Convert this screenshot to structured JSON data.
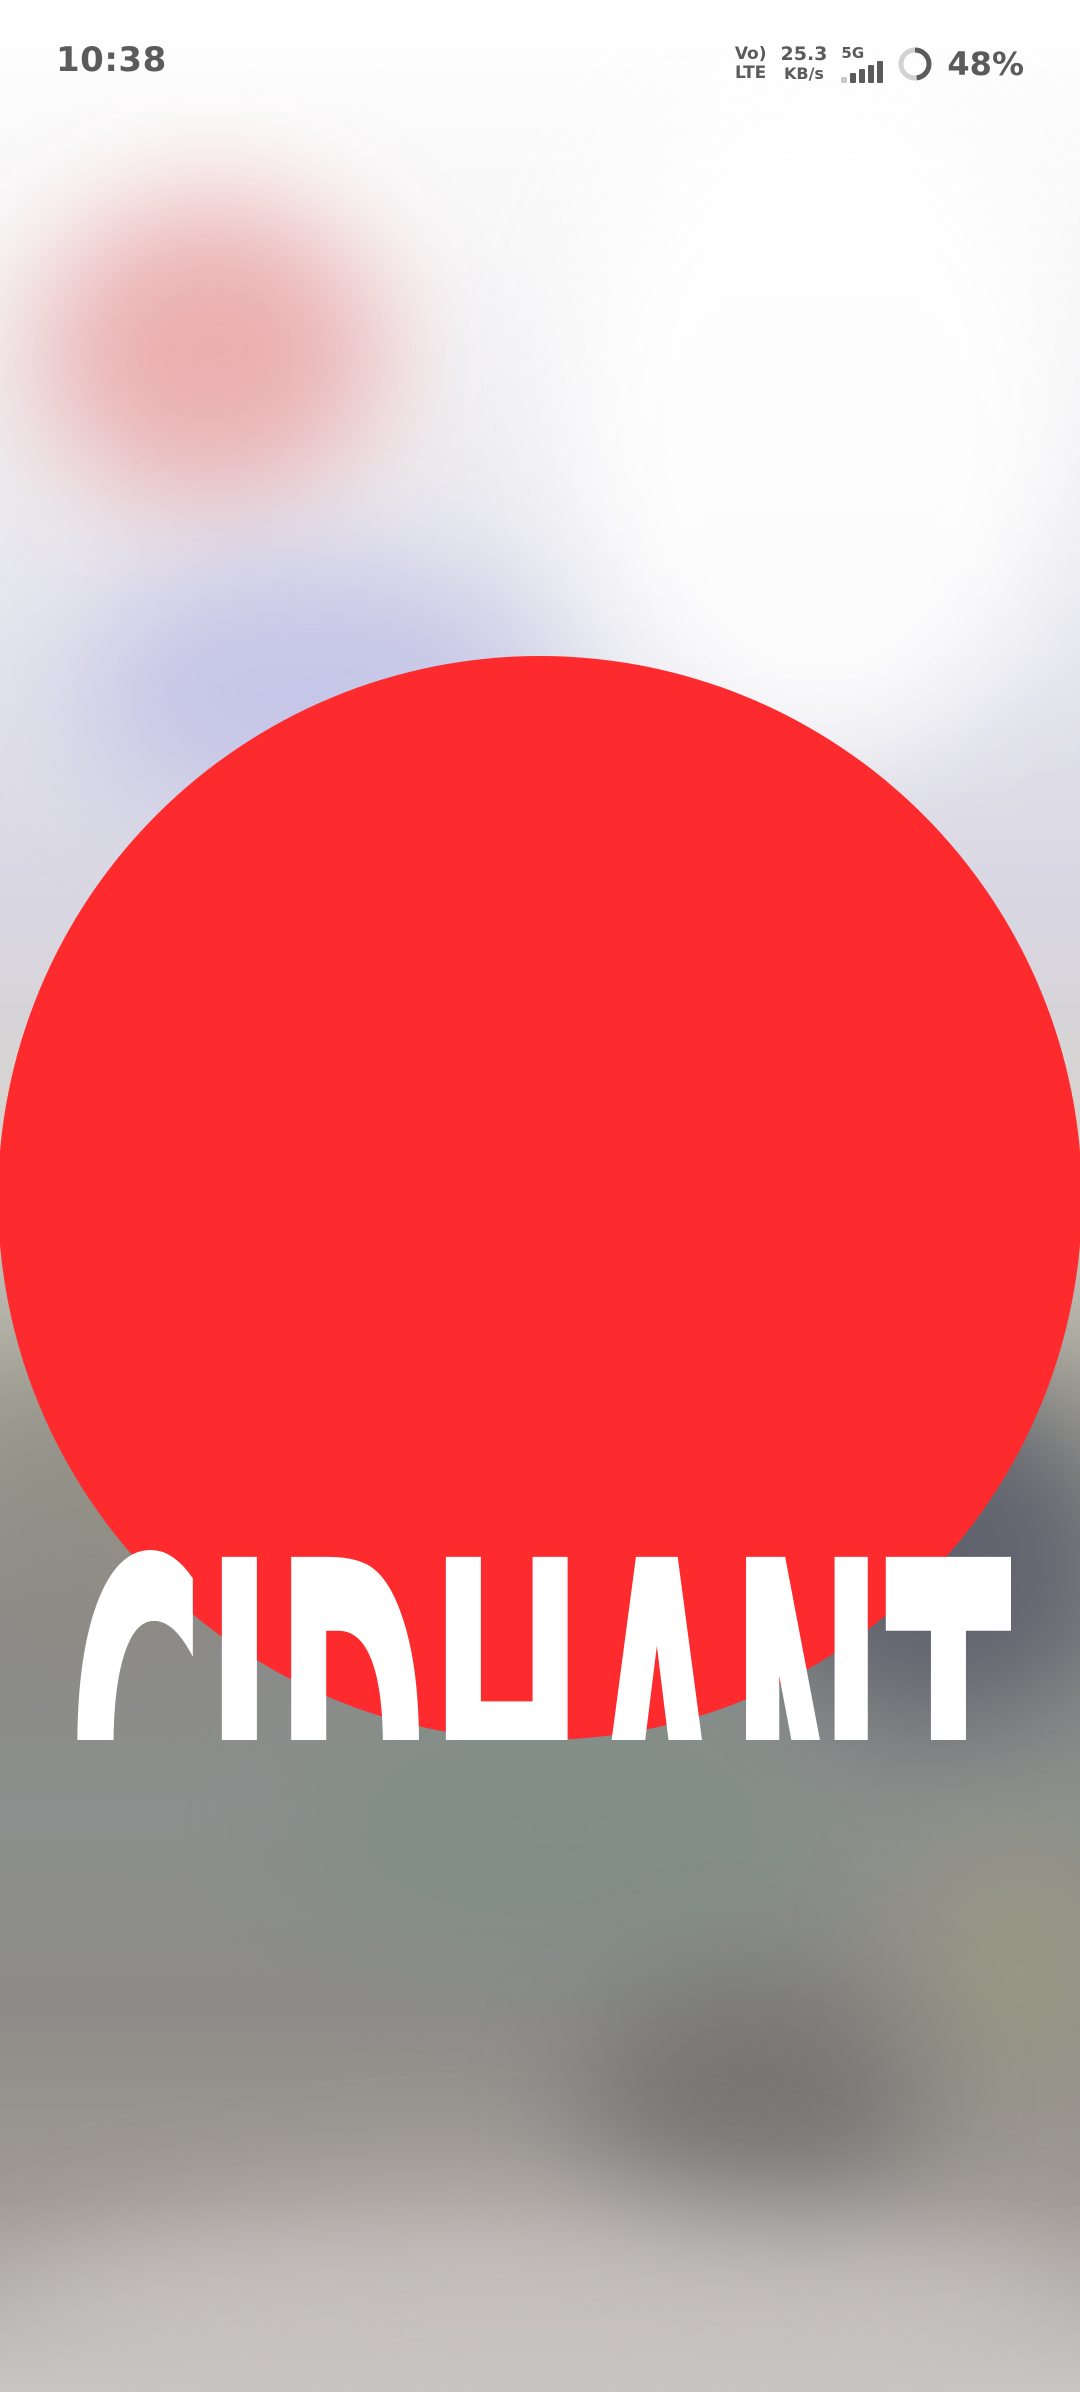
{
  "status_bar": {
    "time": "10:38",
    "volte_top": "Vo)",
    "volte_bottom": "LTE",
    "speed_value": "25.3",
    "speed_unit": "KB/s",
    "network_type": "5G",
    "signal_icon": "signal-bars-icon",
    "battery_icon": "battery-ring-icon",
    "battery_level": 0.48,
    "battery_percent": "48%"
  },
  "logo": {
    "text": "CIDHANT",
    "circle_color": "#fd2b2d",
    "text_color": "#ffffff"
  }
}
